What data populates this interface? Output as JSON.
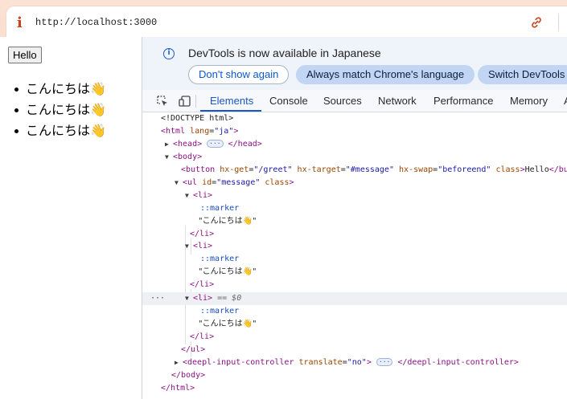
{
  "browser": {
    "url": "http://localhost:3000",
    "info_icon": "info-icon",
    "link_icon": "link-icon"
  },
  "page": {
    "button_label": "Hello",
    "messages": [
      "こんにちは👋",
      "こんにちは👋",
      "こんにちは👋"
    ]
  },
  "devtools": {
    "infobar": {
      "text": "DevTools is now available in Japanese",
      "buttons": [
        "Don't show again",
        "Always match Chrome's language",
        "Switch DevTools"
      ]
    },
    "tabs": [
      "Elements",
      "Console",
      "Sources",
      "Network",
      "Performance",
      "Memory",
      "A"
    ],
    "active_tab": "Elements",
    "dom": {
      "doctype": "<!DOCTYPE html>",
      "html_open": "<html",
      "html_lang_attr": "lang",
      "html_lang_val": "\"ja\"",
      "head": "<head>",
      "head_close": "</head>",
      "ellipsis": "···",
      "body_open": "<body>",
      "button_open": "<button",
      "button_attrs": [
        {
          "name": "hx-get",
          "value": "\"/greet\""
        },
        {
          "name": "hx-target",
          "value": "\"#message\""
        },
        {
          "name": "hx-swap",
          "value": "\"beforeend\""
        }
      ],
      "button_class_attr": "class",
      "button_text": "Hello",
      "button_close": "</button>",
      "ul_open": "<ul",
      "ul_id_attr": "id",
      "ul_id_val": "\"message\"",
      "ul_class_attr": "class",
      "li_open": "<li>",
      "li_close": "</li>",
      "marker": "::marker",
      "li_text": "\"こんにちは👋\"",
      "selected_suffix": "== $0",
      "ul_close": "</ul>",
      "deepl_open": "<deepl-input-controller",
      "deepl_attr": "translate",
      "deepl_val": "\"no\"",
      "deepl_close": "</deepl-input-controller>",
      "body_close": "</body>",
      "html_close": "</html>",
      "gutter_dots": "···"
    }
  }
}
